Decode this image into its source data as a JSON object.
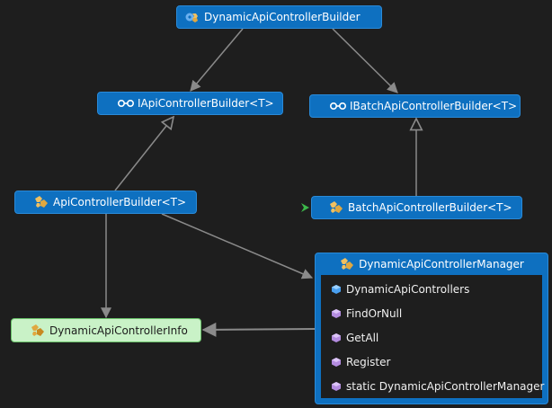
{
  "nodes": {
    "builder": {
      "label": "DynamicApiControllerBuilder"
    },
    "iapi": {
      "label": "IApiControllerBuilder<T>"
    },
    "ibatch": {
      "label": "IBatchApiControllerBuilder<T>"
    },
    "api": {
      "label": "ApiControllerBuilder<T>"
    },
    "batch": {
      "label": "BatchApiControllerBuilder<T>"
    },
    "info": {
      "label": "DynamicApiControllerInfo"
    },
    "manager": {
      "label": "DynamicApiControllerManager",
      "members": [
        {
          "label": "DynamicApiControllers",
          "icon": "property-icon"
        },
        {
          "label": "FindOrNull",
          "icon": "method-icon"
        },
        {
          "label": "GetAll",
          "icon": "method-icon"
        },
        {
          "label": "Register",
          "icon": "method-icon"
        },
        {
          "label": "static DynamicApiControllerManager",
          "icon": "method-icon"
        }
      ]
    }
  },
  "colors": {
    "background": "#1e1e1e",
    "node": "#0e70c0",
    "info_node": "#c9f2c7",
    "connector": "#8a8a8a",
    "class_icon": "#f0c060",
    "method_icon": "#b48ce0",
    "property_icon": "#4aa0f0",
    "entry_arrow": "#3cb84a"
  }
}
